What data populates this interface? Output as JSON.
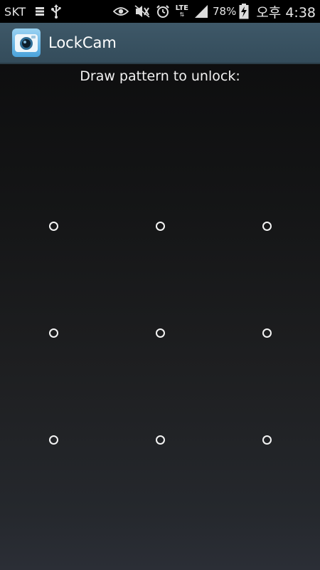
{
  "status_bar": {
    "carrier": "SKT",
    "icons": [
      "sim-storage-icon",
      "usb-icon",
      "eye-icon",
      "vibrate-mute-icon",
      "alarm-icon",
      "lte-icon",
      "signal-icon",
      "battery-charging-icon"
    ],
    "network": "LTE",
    "battery_percent": "78%",
    "time": "오후 4:38"
  },
  "action_bar": {
    "app_icon": "camera-icon",
    "title": "LockCam"
  },
  "lock_screen": {
    "prompt": "Draw pattern to unlock:",
    "dots": [
      {
        "row": 1,
        "col": 1
      },
      {
        "row": 1,
        "col": 2
      },
      {
        "row": 1,
        "col": 3
      },
      {
        "row": 2,
        "col": 1
      },
      {
        "row": 2,
        "col": 2
      },
      {
        "row": 2,
        "col": 3
      },
      {
        "row": 3,
        "col": 1
      },
      {
        "row": 3,
        "col": 2
      },
      {
        "row": 3,
        "col": 3
      }
    ]
  },
  "colors": {
    "action_bar": "#3a5363",
    "text": "#f2f2f2",
    "dot": "#f4f4f4"
  }
}
